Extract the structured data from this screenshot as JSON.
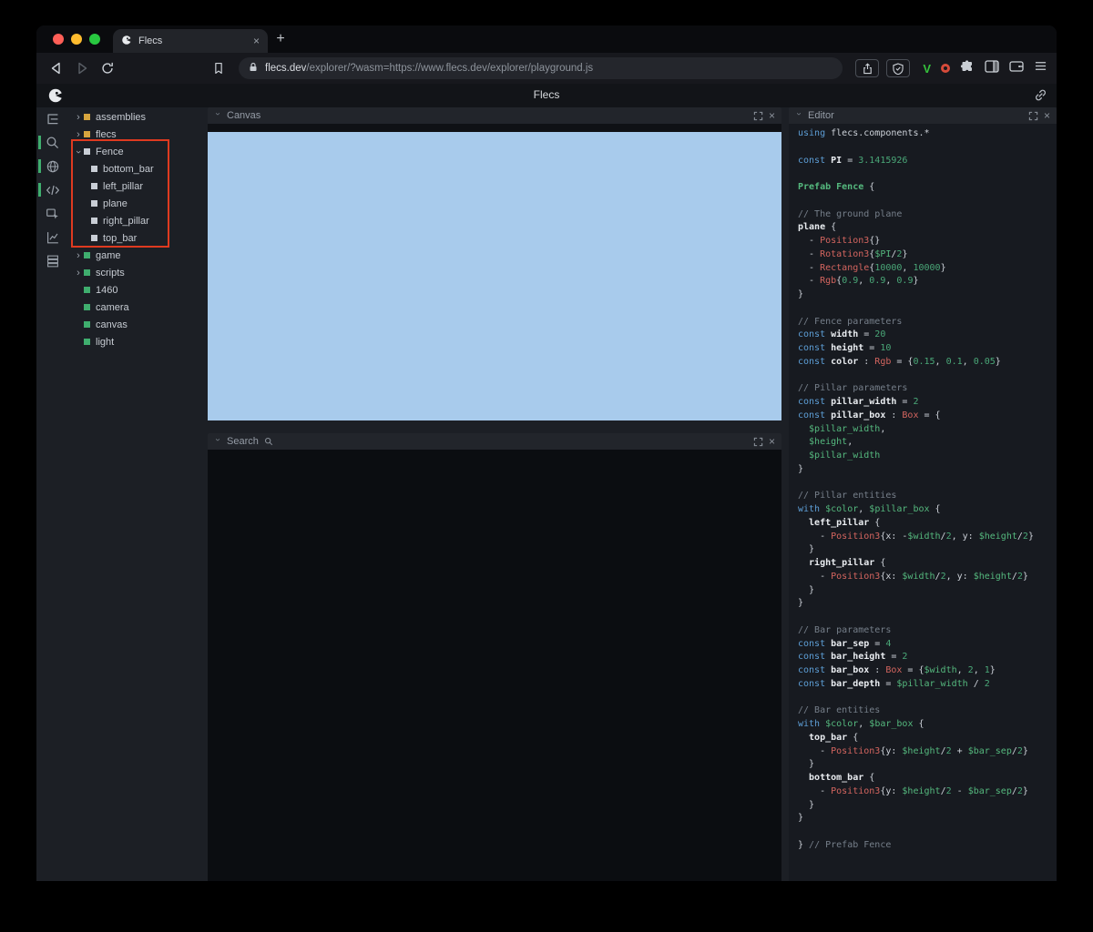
{
  "browser": {
    "tab_title": "Flecs",
    "new_tab_label": "+",
    "url_host": "flecs.dev",
    "url_rest": "/explorer/?wasm=https://www.flecs.dev/explorer/playground.js"
  },
  "app": {
    "title": "Flecs"
  },
  "panels": {
    "canvas": {
      "title": "Canvas"
    },
    "search": {
      "title": "Search"
    },
    "editor": {
      "title": "Editor"
    }
  },
  "icons": {
    "toolbar": [
      "entity-tree-icon",
      "search-icon",
      "world-icon",
      "code-icon",
      "inspector-icon",
      "stats-icon",
      "memory-icon"
    ],
    "active_toolbar": [
      "search-icon",
      "world-icon",
      "code-icon"
    ]
  },
  "colors": {
    "canvas_blue": "#a8cbec",
    "annotation_red": "#df3a20",
    "accent_green": "#3fae6e",
    "entity_yellow": "#d7a53e"
  },
  "tree": {
    "items": [
      {
        "depth": 0,
        "chevron": "right",
        "color": "yellow",
        "label": "assemblies"
      },
      {
        "depth": 0,
        "chevron": "right",
        "color": "yellow",
        "label": "flecs"
      },
      {
        "depth": 0,
        "chevron": "down",
        "color": "white",
        "label": "Fence"
      },
      {
        "depth": 1,
        "chevron": "none",
        "color": "white",
        "label": "bottom_bar"
      },
      {
        "depth": 1,
        "chevron": "none",
        "color": "white",
        "label": "left_pillar"
      },
      {
        "depth": 1,
        "chevron": "none",
        "color": "white",
        "label": "plane"
      },
      {
        "depth": 1,
        "chevron": "none",
        "color": "white",
        "label": "right_pillar"
      },
      {
        "depth": 1,
        "chevron": "none",
        "color": "white",
        "label": "top_bar"
      },
      {
        "depth": 0,
        "chevron": "right",
        "color": "green",
        "label": "game"
      },
      {
        "depth": 0,
        "chevron": "right",
        "color": "green",
        "label": "scripts"
      },
      {
        "depth": 0,
        "chevron": "none",
        "color": "green",
        "label": "1460"
      },
      {
        "depth": 0,
        "chevron": "none",
        "color": "green",
        "label": "camera"
      },
      {
        "depth": 0,
        "chevron": "none",
        "color": "green",
        "label": "canvas"
      },
      {
        "depth": 0,
        "chevron": "none",
        "color": "green",
        "label": "light"
      }
    ]
  },
  "editor": {
    "lines": [
      [
        [
          "kw",
          "using"
        ],
        [
          "pl",
          " flecs.components.*"
        ]
      ],
      [],
      [
        [
          "kw",
          "const"
        ],
        [
          "ent",
          " PI"
        ],
        [
          "pl",
          " = "
        ],
        [
          "num",
          "3.1415926"
        ]
      ],
      [],
      [
        [
          "grn",
          "Prefab Fence"
        ],
        [
          "pl",
          " {"
        ]
      ],
      [],
      [
        [
          "cm",
          "// The ground plane"
        ]
      ],
      [
        [
          "ent",
          "plane"
        ],
        [
          "pl",
          " {"
        ]
      ],
      [
        [
          "pl",
          "  - "
        ],
        [
          "cmp",
          "Position3"
        ],
        [
          "pl",
          "{}"
        ]
      ],
      [
        [
          "pl",
          "  - "
        ],
        [
          "cmp",
          "Rotation3"
        ],
        [
          "pl",
          "{"
        ],
        [
          "var",
          "$PI"
        ],
        [
          "pl",
          "/"
        ],
        [
          "num",
          "2"
        ],
        [
          "pl",
          "}"
        ]
      ],
      [
        [
          "pl",
          "  - "
        ],
        [
          "cmp",
          "Rectangle"
        ],
        [
          "pl",
          "{"
        ],
        [
          "num",
          "10000"
        ],
        [
          "pl",
          ", "
        ],
        [
          "num",
          "10000"
        ],
        [
          "pl",
          "}"
        ]
      ],
      [
        [
          "pl",
          "  - "
        ],
        [
          "cmp",
          "Rgb"
        ],
        [
          "pl",
          "{"
        ],
        [
          "num",
          "0.9"
        ],
        [
          "pl",
          ", "
        ],
        [
          "num",
          "0.9"
        ],
        [
          "pl",
          ", "
        ],
        [
          "num",
          "0.9"
        ],
        [
          "pl",
          "}"
        ]
      ],
      [
        [
          "pl",
          "}"
        ]
      ],
      [],
      [
        [
          "cm",
          "// Fence parameters"
        ]
      ],
      [
        [
          "kw",
          "const"
        ],
        [
          "ent",
          " width"
        ],
        [
          "pl",
          " = "
        ],
        [
          "num",
          "20"
        ]
      ],
      [
        [
          "kw",
          "const"
        ],
        [
          "ent",
          " height"
        ],
        [
          "pl",
          " = "
        ],
        [
          "num",
          "10"
        ]
      ],
      [
        [
          "kw",
          "const"
        ],
        [
          "ent",
          " color"
        ],
        [
          "pl",
          " : "
        ],
        [
          "cmp",
          "Rgb"
        ],
        [
          "pl",
          " = {"
        ],
        [
          "num",
          "0.15"
        ],
        [
          "pl",
          ", "
        ],
        [
          "num",
          "0.1"
        ],
        [
          "pl",
          ", "
        ],
        [
          "num",
          "0.05"
        ],
        [
          "pl",
          "}"
        ]
      ],
      [],
      [
        [
          "cm",
          "// Pillar parameters"
        ]
      ],
      [
        [
          "kw",
          "const"
        ],
        [
          "ent",
          " pillar_width"
        ],
        [
          "pl",
          " = "
        ],
        [
          "num",
          "2"
        ]
      ],
      [
        [
          "kw",
          "const"
        ],
        [
          "ent",
          " pillar_box"
        ],
        [
          "pl",
          " : "
        ],
        [
          "cmp",
          "Box"
        ],
        [
          "pl",
          " = {"
        ]
      ],
      [
        [
          "var",
          "  $pillar_width"
        ],
        [
          "pl",
          ","
        ]
      ],
      [
        [
          "var",
          "  $height"
        ],
        [
          "pl",
          ","
        ]
      ],
      [
        [
          "var",
          "  $pillar_width"
        ]
      ],
      [
        [
          "pl",
          "}"
        ]
      ],
      [],
      [
        [
          "cm",
          "// Pillar entities"
        ]
      ],
      [
        [
          "kw",
          "with"
        ],
        [
          "var",
          " $color"
        ],
        [
          "pl",
          ", "
        ],
        [
          "var",
          "$pillar_box"
        ],
        [
          "pl",
          " {"
        ]
      ],
      [
        [
          "ent",
          "  left_pillar"
        ],
        [
          "pl",
          " {"
        ]
      ],
      [
        [
          "pl",
          "    - "
        ],
        [
          "cmp",
          "Position3"
        ],
        [
          "pl",
          "{x: -"
        ],
        [
          "var",
          "$width"
        ],
        [
          "pl",
          "/"
        ],
        [
          "num",
          "2"
        ],
        [
          "pl",
          ", y: "
        ],
        [
          "var",
          "$height"
        ],
        [
          "pl",
          "/"
        ],
        [
          "num",
          "2"
        ],
        [
          "pl",
          "}"
        ]
      ],
      [
        [
          "pl",
          "  }"
        ]
      ],
      [
        [
          "ent",
          "  right_pillar"
        ],
        [
          "pl",
          " {"
        ]
      ],
      [
        [
          "pl",
          "    - "
        ],
        [
          "cmp",
          "Position3"
        ],
        [
          "pl",
          "{x: "
        ],
        [
          "var",
          "$width"
        ],
        [
          "pl",
          "/"
        ],
        [
          "num",
          "2"
        ],
        [
          "pl",
          ", y: "
        ],
        [
          "var",
          "$height"
        ],
        [
          "pl",
          "/"
        ],
        [
          "num",
          "2"
        ],
        [
          "pl",
          "}"
        ]
      ],
      [
        [
          "pl",
          "  }"
        ]
      ],
      [
        [
          "pl",
          "}"
        ]
      ],
      [],
      [
        [
          "cm",
          "// Bar parameters"
        ]
      ],
      [
        [
          "kw",
          "const"
        ],
        [
          "ent",
          " bar_sep"
        ],
        [
          "pl",
          " = "
        ],
        [
          "num",
          "4"
        ]
      ],
      [
        [
          "kw",
          "const"
        ],
        [
          "ent",
          " bar_height"
        ],
        [
          "pl",
          " = "
        ],
        [
          "num",
          "2"
        ]
      ],
      [
        [
          "kw",
          "const"
        ],
        [
          "ent",
          " bar_box"
        ],
        [
          "pl",
          " : "
        ],
        [
          "cmp",
          "Box"
        ],
        [
          "pl",
          " = {"
        ],
        [
          "var",
          "$width"
        ],
        [
          "pl",
          ", "
        ],
        [
          "num",
          "2"
        ],
        [
          "pl",
          ", "
        ],
        [
          "num",
          "1"
        ],
        [
          "pl",
          "}"
        ]
      ],
      [
        [
          "kw",
          "const"
        ],
        [
          "ent",
          " bar_depth"
        ],
        [
          "pl",
          " = "
        ],
        [
          "var",
          "$pillar_width"
        ],
        [
          "pl",
          " / "
        ],
        [
          "num",
          "2"
        ]
      ],
      [],
      [
        [
          "cm",
          "// Bar entities"
        ]
      ],
      [
        [
          "kw",
          "with"
        ],
        [
          "var",
          " $color"
        ],
        [
          "pl",
          ", "
        ],
        [
          "var",
          "$bar_box"
        ],
        [
          "pl",
          " {"
        ]
      ],
      [
        [
          "ent",
          "  top_bar"
        ],
        [
          "pl",
          " {"
        ]
      ],
      [
        [
          "pl",
          "    - "
        ],
        [
          "cmp",
          "Position3"
        ],
        [
          "pl",
          "{y: "
        ],
        [
          "var",
          "$height"
        ],
        [
          "pl",
          "/"
        ],
        [
          "num",
          "2"
        ],
        [
          "pl",
          " + "
        ],
        [
          "var",
          "$bar_sep"
        ],
        [
          "pl",
          "/"
        ],
        [
          "num",
          "2"
        ],
        [
          "pl",
          "}"
        ]
      ],
      [
        [
          "pl",
          "  }"
        ]
      ],
      [
        [
          "ent",
          "  bottom_bar"
        ],
        [
          "pl",
          " {"
        ]
      ],
      [
        [
          "pl",
          "    - "
        ],
        [
          "cmp",
          "Position3"
        ],
        [
          "pl",
          "{y: "
        ],
        [
          "var",
          "$height"
        ],
        [
          "pl",
          "/"
        ],
        [
          "num",
          "2"
        ],
        [
          "pl",
          " - "
        ],
        [
          "var",
          "$bar_sep"
        ],
        [
          "pl",
          "/"
        ],
        [
          "num",
          "2"
        ],
        [
          "pl",
          "}"
        ]
      ],
      [
        [
          "pl",
          "  }"
        ]
      ],
      [
        [
          "pl",
          "}"
        ]
      ],
      [],
      [
        [
          "pl",
          "} "
        ],
        [
          "cm",
          "// Prefab Fence"
        ]
      ]
    ]
  }
}
